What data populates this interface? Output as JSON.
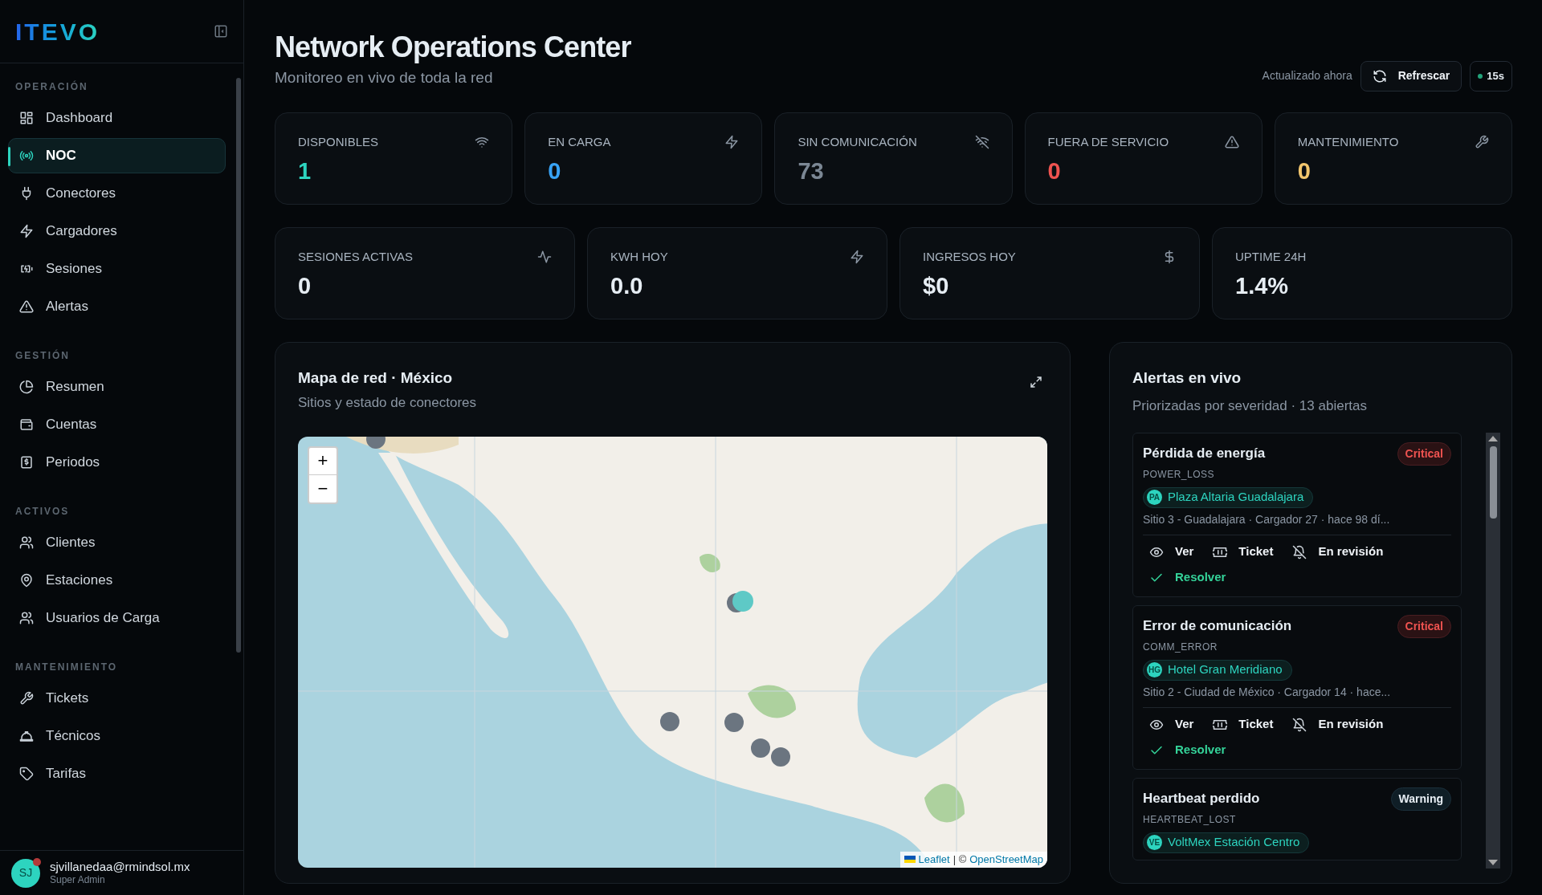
{
  "sidebar": {
    "logo": "ITEVO",
    "sections": [
      {
        "heading": "OPERACIÓN",
        "items": [
          {
            "label": "Dashboard",
            "selected": false
          },
          {
            "label": "NOC",
            "selected": true
          },
          {
            "label": "Conectores",
            "selected": false
          },
          {
            "label": "Cargadores",
            "selected": false
          },
          {
            "label": "Sesiones",
            "selected": false
          },
          {
            "label": "Alertas",
            "selected": false
          }
        ]
      },
      {
        "heading": "GESTIÓN",
        "items": [
          {
            "label": "Resumen",
            "selected": false
          },
          {
            "label": "Cuentas",
            "selected": false
          },
          {
            "label": "Periodos",
            "selected": false
          }
        ]
      },
      {
        "heading": "ACTIVOS",
        "items": [
          {
            "label": "Clientes",
            "selected": false
          },
          {
            "label": "Estaciones",
            "selected": false
          },
          {
            "label": "Usuarios de Carga",
            "selected": false
          }
        ]
      },
      {
        "heading": "MANTENIMIENTO",
        "items": [
          {
            "label": "Tickets",
            "selected": false
          },
          {
            "label": "Técnicos",
            "selected": false
          },
          {
            "label": "Tarifas",
            "selected": false
          }
        ]
      }
    ],
    "user": {
      "initials": "SJ",
      "email": "sjvillanedaa@rmindsol.mx",
      "role": "Super Admin"
    }
  },
  "header": {
    "title": "Network Operations Center",
    "subtitle": "Monitoreo en vivo de toda la red",
    "updated": "Actualizado ahora",
    "refresh": "Refrescar",
    "interval": "15s"
  },
  "status_cards": [
    {
      "label": "DISPONIBLES",
      "value": "1",
      "color": "#2dd4bf"
    },
    {
      "label": "EN CARGA",
      "value": "0",
      "color": "#38a3f5"
    },
    {
      "label": "SIN COMUNICACIÓN",
      "value": "73",
      "color": "#7b8794"
    },
    {
      "label": "FUERA DE SERVICIO",
      "value": "0",
      "color": "#ef5350"
    },
    {
      "label": "MANTENIMIENTO",
      "value": "0",
      "color": "#f2c66d"
    }
  ],
  "kpi_cards": [
    {
      "label": "SESIONES ACTIVAS",
      "value": "0"
    },
    {
      "label": "KWH HOY",
      "value": "0.0"
    },
    {
      "label": "INGRESOS HOY",
      "value": "$0"
    },
    {
      "label": "UPTIME 24H",
      "value": "1.4%"
    }
  ],
  "map": {
    "title": "Mapa de red · México",
    "subtitle": "Sitios y estado de conectores",
    "zoom_in": "+",
    "zoom_out": "−",
    "attribution": {
      "leaflet": "Leaflet",
      "separator": "| ©",
      "osm": "OpenStreetMap"
    }
  },
  "alerts": {
    "title": "Alertas en vivo",
    "subtitle": "Priorizadas por severidad · 13 abiertas",
    "items": [
      {
        "title": "Pérdida de energía",
        "code": "POWER_LOSS",
        "severity": "Critical",
        "kind": "critical",
        "site_initials": "PA",
        "site": "Plaza Altaria Guadalajara",
        "detail": "Sitio 3 - Guadalajara · Cargador 27 · hace 98 dí...",
        "actions": [
          "Ver",
          "Ticket",
          "En revisión"
        ],
        "resolve": "Resolver"
      },
      {
        "title": "Error de comunicación",
        "code": "COMM_ERROR",
        "severity": "Critical",
        "kind": "critical",
        "site_initials": "HG",
        "site": "Hotel Gran Meridiano",
        "detail": "Sitio 2 - Ciudad de México · Cargador 14 · hace...",
        "actions": [
          "Ver",
          "Ticket",
          "En revisión"
        ],
        "resolve": "Resolver"
      },
      {
        "title": "Heartbeat perdido",
        "code": "HEARTBEAT_LOST",
        "severity": "Warning",
        "kind": "warning",
        "site_initials": "VE",
        "site": "VoltMex Estación Centro"
      }
    ]
  }
}
